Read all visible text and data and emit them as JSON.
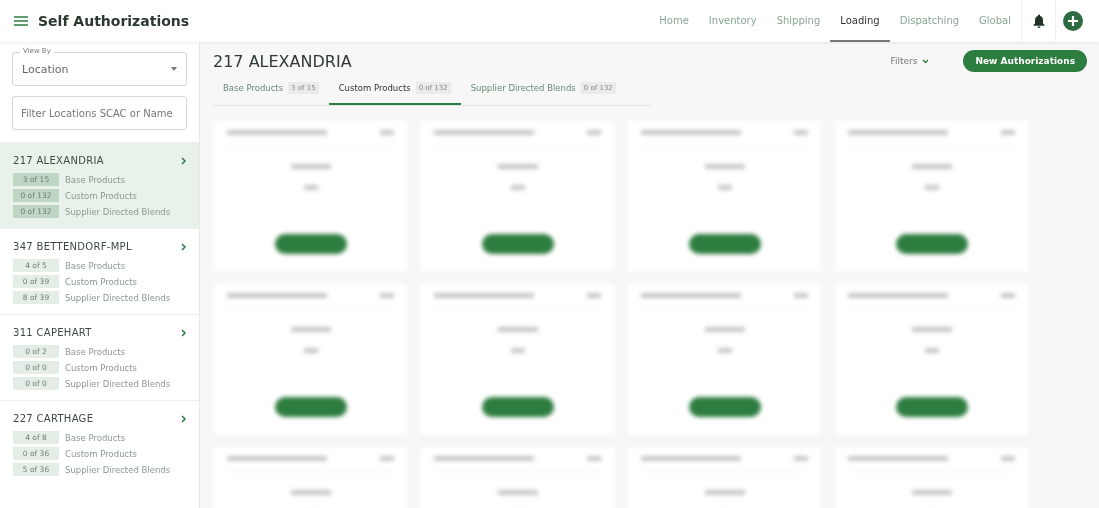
{
  "header": {
    "title": "Self Authorizations"
  },
  "nav": [
    {
      "label": "Home",
      "selected": false
    },
    {
      "label": "Inventory",
      "selected": false
    },
    {
      "label": "Shipping",
      "selected": false
    },
    {
      "label": "Loading",
      "selected": true
    },
    {
      "label": "Dispatching",
      "selected": false
    },
    {
      "label": "Global",
      "selected": false
    }
  ],
  "sidebar": {
    "view_by": {
      "label": "View By",
      "value": "Location"
    },
    "filter": {
      "placeholder": "Filter Locations SCAC or Name"
    },
    "locations": [
      {
        "name": "217 ALEXANDRIA",
        "selected": true,
        "counts": [
          {
            "count": "3 of 15",
            "label": "Base Products"
          },
          {
            "count": "0 of 132",
            "label": "Custom Products"
          },
          {
            "count": "0 of 132",
            "label": "Supplier Directed Blends"
          }
        ]
      },
      {
        "name": "347 BETTENDORF-MPL",
        "selected": false,
        "counts": [
          {
            "count": "4 of 5",
            "label": "Base Products"
          },
          {
            "count": "0 of 39",
            "label": "Custom Products"
          },
          {
            "count": "8 of 39",
            "label": "Supplier Directed Blends"
          }
        ]
      },
      {
        "name": "311 CAPEHART",
        "selected": false,
        "counts": [
          {
            "count": "0 of 2",
            "label": "Base Products"
          },
          {
            "count": "0 of 0",
            "label": "Custom Products"
          },
          {
            "count": "0 of 0",
            "label": "Supplier Directed Blends"
          }
        ]
      },
      {
        "name": "227 CARTHAGE",
        "selected": false,
        "counts": [
          {
            "count": "4 of 8",
            "label": "Base Products"
          },
          {
            "count": "0 of 36",
            "label": "Custom Products"
          },
          {
            "count": "5 of 36",
            "label": "Supplier Directed Blends"
          }
        ]
      }
    ]
  },
  "main": {
    "title": "217 ALEXANDRIA",
    "filters": "Filters",
    "new_button": "New Authorizations",
    "tabs": [
      {
        "label": "Base Products",
        "count": "3 of 15",
        "selected": false
      },
      {
        "label": "Custom Products",
        "count": "0 of 132",
        "selected": true
      },
      {
        "label": "Supplier Directed Blends",
        "count": "0 of 132",
        "selected": false
      }
    ],
    "cards": [
      {
        "kind": "blurred"
      },
      {
        "kind": "blurred"
      },
      {
        "kind": "blurred"
      },
      {
        "kind": "blurred"
      },
      {
        "kind": "blurred"
      },
      {
        "kind": "blurred"
      },
      {
        "kind": "blurred"
      },
      {
        "kind": "blurred"
      },
      {
        "kind": "blurred"
      },
      {
        "kind": "blurred"
      },
      {
        "kind": "blurred"
      },
      {
        "kind": "blurred"
      }
    ]
  }
}
